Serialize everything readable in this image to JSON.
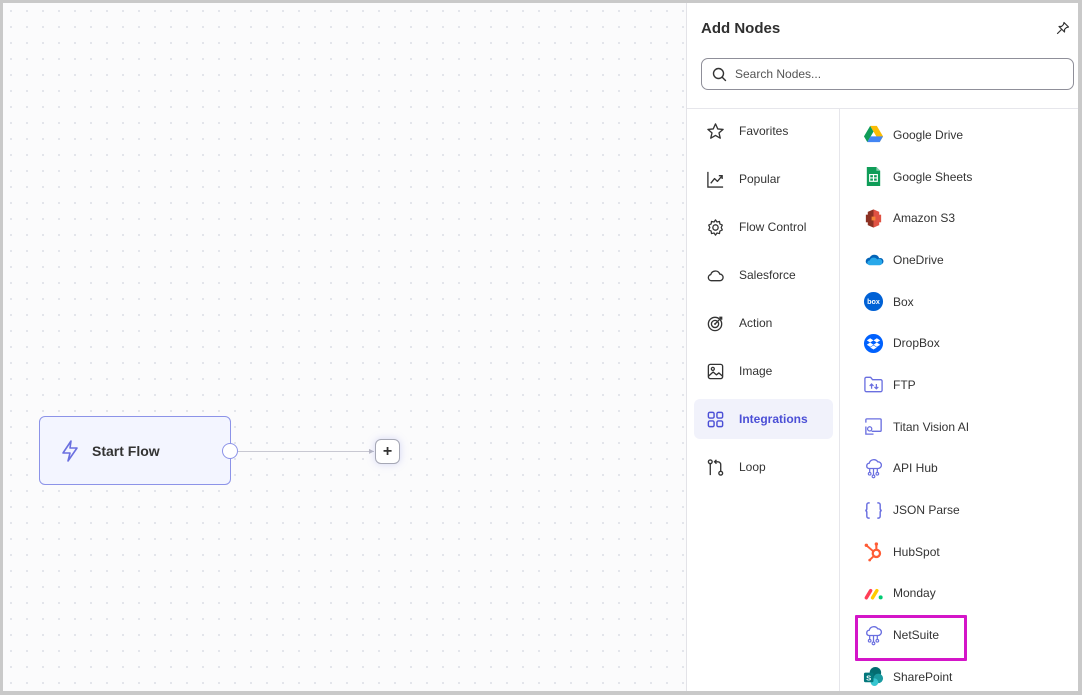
{
  "canvas": {
    "start_node": {
      "label": "Start Flow",
      "icon": "lightning-icon"
    },
    "add_button": {
      "label": "+"
    }
  },
  "panel": {
    "title": "Add Nodes",
    "pin_icon": "pin-icon",
    "search": {
      "placeholder": "Search Nodes...",
      "value": ""
    },
    "categories": [
      {
        "label": "Favorites",
        "icon": "star-icon"
      },
      {
        "label": "Popular",
        "icon": "trend-chart-icon"
      },
      {
        "label": "Flow Control",
        "icon": "gear-icon"
      },
      {
        "label": "Salesforce",
        "icon": "cloud-icon"
      },
      {
        "label": "Action",
        "icon": "target-icon"
      },
      {
        "label": "Image",
        "icon": "image-icon"
      },
      {
        "label": "Integrations",
        "icon": "grid-icon",
        "active": true
      },
      {
        "label": "Loop",
        "icon": "loop-icon"
      }
    ],
    "integrations": [
      {
        "label": "Google Drive",
        "icon": "google-drive-icon"
      },
      {
        "label": "Google Sheets",
        "icon": "google-sheets-icon"
      },
      {
        "label": "Amazon S3",
        "icon": "amazon-s3-icon"
      },
      {
        "label": "OneDrive",
        "icon": "onedrive-icon"
      },
      {
        "label": "Box",
        "icon": "box-icon"
      },
      {
        "label": "DropBox",
        "icon": "dropbox-icon"
      },
      {
        "label": "FTP",
        "icon": "ftp-folder-icon"
      },
      {
        "label": "Titan Vision AI",
        "icon": "vision-ai-icon"
      },
      {
        "label": "API Hub",
        "icon": "api-hub-icon"
      },
      {
        "label": "JSON Parse",
        "icon": "braces-icon"
      },
      {
        "label": "HubSpot",
        "icon": "hubspot-icon"
      },
      {
        "label": "Monday",
        "icon": "monday-icon"
      },
      {
        "label": "NetSuite",
        "icon": "netsuite-icon",
        "highlighted": true
      },
      {
        "label": "SharePoint",
        "icon": "sharepoint-icon"
      }
    ]
  },
  "colors": {
    "accent": "#4b4fd6",
    "node_border": "#8c93e8",
    "highlight": "#d415c8"
  }
}
